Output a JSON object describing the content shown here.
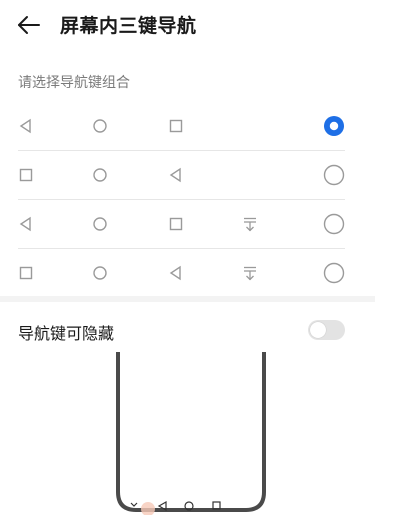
{
  "header": {
    "title": "屏幕内三键导航",
    "back_icon": "arrow-left-icon"
  },
  "section": {
    "label": "请选择导航键组合"
  },
  "combinations": [
    {
      "keys": [
        "back-triangle-icon",
        "home-circle-icon",
        "recents-square-icon"
      ],
      "selected": true
    },
    {
      "keys": [
        "recents-square-icon",
        "home-circle-icon",
        "back-triangle-icon"
      ],
      "selected": false
    },
    {
      "keys": [
        "back-triangle-icon",
        "home-circle-icon",
        "recents-square-icon",
        "hide-nav-icon"
      ],
      "selected": false
    },
    {
      "keys": [
        "recents-square-icon",
        "home-circle-icon",
        "back-triangle-icon",
        "hide-nav-icon"
      ],
      "selected": false
    }
  ],
  "hide_toggle": {
    "label": "导航键可隐藏",
    "on": false
  },
  "colors": {
    "accent": "#1e6fe6",
    "icon_gray": "#9a9a9a",
    "switch_off": "#e3e3e3"
  }
}
